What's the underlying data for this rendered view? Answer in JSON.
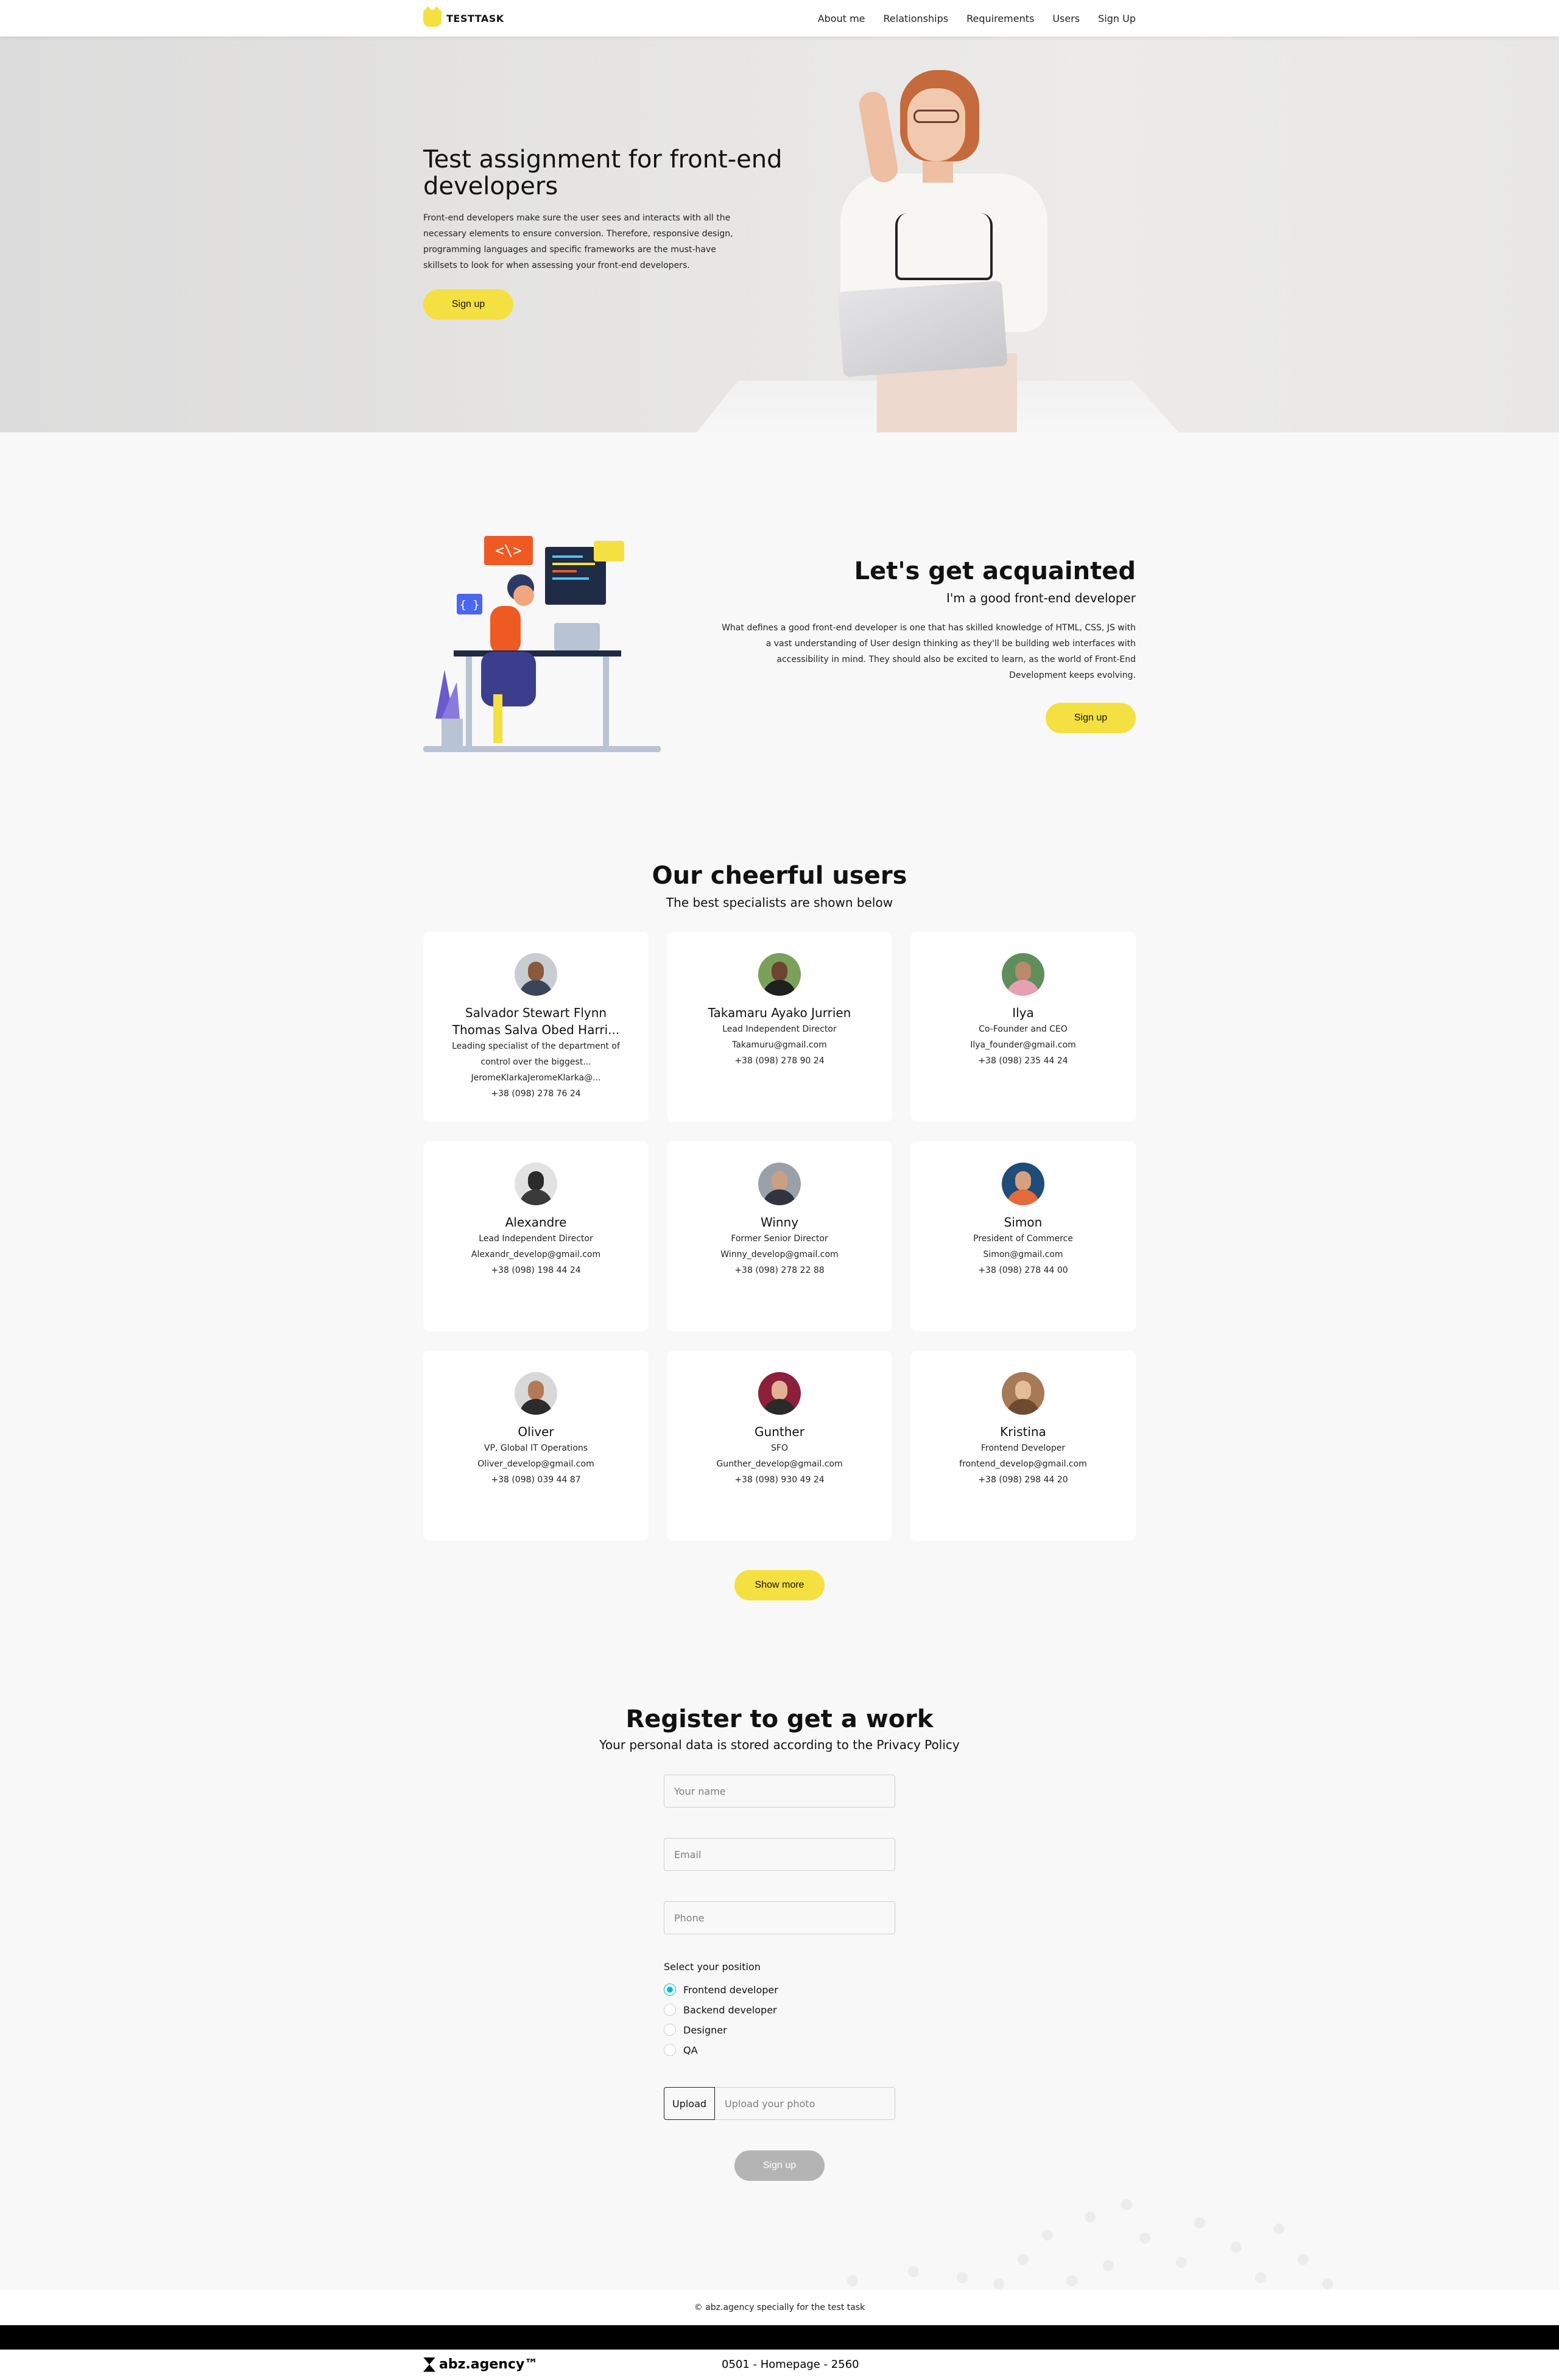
{
  "header": {
    "logo_text": "TESTTASK",
    "nav": [
      "About me",
      "Relationships",
      "Requirements",
      "Users",
      "Sign Up"
    ]
  },
  "hero": {
    "title": "Test assignment for front-end developers",
    "text": "Front-end developers make sure the user sees and interacts with all the necessary elements to ensure conversion. Therefore, responsive design, programming languages and specific frameworks are the must-have skillsets to look for when assessing your front-end developers.",
    "button": "Sign up"
  },
  "acquaint": {
    "title": "Let's get acquainted",
    "subtitle": "I'm a good front-end developer",
    "text": "What defines a good front-end developer is one that has skilled knowledge of HTML, CSS, JS with a vast understanding of User design thinking as they'll be building web interfaces with accessibility in mind. They should also be excited to learn, as the world of Front-End Development keeps evolving.",
    "button": "Sign up"
  },
  "users": {
    "title": "Our cheerful users",
    "subtitle": "The best specialists are shown below",
    "cards": [
      {
        "name": "Salvador Stewart Flynn Thomas Salva Obed Harri...",
        "position": "Leading specialist of the department of control over the biggest...",
        "email": "JeromeKlarkaJeromeKlarka@...",
        "phone": "+38 (098) 278 76 24"
      },
      {
        "name": "Takamaru Ayako Jurrien",
        "position": "Lead Independent Director",
        "email": "Takamuru@gmail.com",
        "phone": "+38 (098) 278 90 24"
      },
      {
        "name": "Ilya",
        "position": "Co-Founder and CEO",
        "email": "Ilya_founder@gmail.com",
        "phone": "+38 (098) 235 44 24"
      },
      {
        "name": "Alexandre",
        "position": "Lead Independent Director",
        "email": "Alexandr_develop@gmail.com",
        "phone": "+38 (098) 198 44 24"
      },
      {
        "name": "Winny",
        "position": "Former Senior Director",
        "email": "Winny_develop@gmail.com",
        "phone": "+38 (098) 278 22 88"
      },
      {
        "name": "Simon",
        "position": "President of Commerce",
        "email": "Simon@gmail.com",
        "phone": "+38 (098) 278 44 00"
      },
      {
        "name": "Oliver",
        "position": "VP, Global IT Operations",
        "email": "Oliver_develop@gmail.com",
        "phone": "+38 (098) 039 44 87"
      },
      {
        "name": "Gunther",
        "position": "SFO",
        "email": "Gunther_develop@gmail.com",
        "phone": "+38 (098) 930 49 24"
      },
      {
        "name": "Kristina",
        "position": "Frontend Developer",
        "email": "frontend_develop@gmail.com",
        "phone": "+38 (098) 298 44 20"
      }
    ],
    "show_more": "Show more"
  },
  "register": {
    "title": "Register to get a work",
    "subtitle": "Your personal data is stored according to the Privacy Policy",
    "name_placeholder": "Your name",
    "email_placeholder": "Email",
    "phone_placeholder": "Phone",
    "position_label": "Select your position",
    "positions": [
      "Frontend developer",
      "Backend developer",
      "Designer",
      "QA"
    ],
    "selected_position": "Frontend developer",
    "upload_button": "Upload",
    "upload_placeholder": "Upload your photo",
    "submit": "Sign up"
  },
  "footer": {
    "copyright": "© abz.agency specially for the test task",
    "brand": "abz.agency™",
    "page_id": "0501 - Homepage - 2560"
  },
  "colors": {
    "accent": "#f4e041",
    "radio": "#00bdd3",
    "disabled": "#b4b4b4"
  }
}
